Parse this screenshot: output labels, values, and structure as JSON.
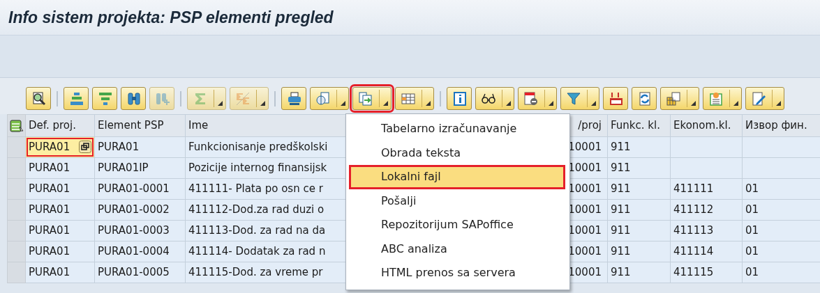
{
  "window": {
    "title": "Info sistem projekta: PSP elementi pregled"
  },
  "toolbar": [
    {
      "kind": "button",
      "dropdown": false,
      "disabled": false,
      "highlighted": false
    },
    {
      "kind": "separator"
    },
    {
      "kind": "button",
      "dropdown": false,
      "disabled": false,
      "highlighted": false
    },
    {
      "kind": "button",
      "dropdown": false,
      "disabled": false,
      "highlighted": false
    },
    {
      "kind": "button",
      "dropdown": false,
      "disabled": false,
      "highlighted": false
    },
    {
      "kind": "button",
      "dropdown": false,
      "disabled": true,
      "highlighted": false
    },
    {
      "kind": "separator"
    },
    {
      "kind": "button",
      "dropdown": true,
      "disabled": true,
      "highlighted": false
    },
    {
      "kind": "button",
      "dropdown": true,
      "disabled": true,
      "highlighted": false
    },
    {
      "kind": "separator"
    },
    {
      "kind": "button",
      "dropdown": false,
      "disabled": false,
      "highlighted": false
    },
    {
      "kind": "button",
      "dropdown": true,
      "disabled": false,
      "highlighted": false
    },
    {
      "kind": "button",
      "dropdown": true,
      "disabled": false,
      "highlighted": true
    },
    {
      "kind": "button",
      "dropdown": true,
      "disabled": false,
      "highlighted": false
    },
    {
      "kind": "separator"
    },
    {
      "kind": "button",
      "dropdown": false,
      "disabled": false,
      "highlighted": false
    },
    {
      "kind": "button",
      "dropdown": true,
      "disabled": false,
      "highlighted": false
    },
    {
      "kind": "button",
      "dropdown": true,
      "disabled": false,
      "highlighted": false
    },
    {
      "kind": "button",
      "dropdown": true,
      "disabled": false,
      "highlighted": false
    },
    {
      "kind": "button",
      "dropdown": false,
      "disabled": false,
      "highlighted": false
    },
    {
      "kind": "button",
      "dropdown": false,
      "disabled": false,
      "highlighted": false
    },
    {
      "kind": "button",
      "dropdown": true,
      "disabled": false,
      "highlighted": false
    },
    {
      "kind": "button",
      "dropdown": true,
      "disabled": false,
      "highlighted": false
    },
    {
      "kind": "button",
      "dropdown": true,
      "disabled": false,
      "highlighted": false
    }
  ],
  "table": {
    "columns": [
      "Def. proj.",
      "Element PSP",
      "Ime",
      "/proj",
      "Funkc. kl.",
      "Ekonom.kl.",
      "Извор фин."
    ],
    "rows": [
      {
        "current": true,
        "def_proj": "PURA01",
        "element_psp": "PURA01",
        "ime": "Funkcionisanje predškolski",
        "proj": "10001",
        "funkc": "911"
      },
      {
        "current": false,
        "def_proj": "PURA01",
        "element_psp": "PURA01IP",
        "ime": "Pozicije internog finansijsk",
        "proj": "10001",
        "funkc": "911"
      },
      {
        "current": false,
        "def_proj": "PURA01",
        "element_psp": "PURA01-0001",
        "ime": "411111- Plata po osn ce r",
        "proj": "10001",
        "funkc": "911",
        "ekonom": "411111",
        "izvor": "01"
      },
      {
        "current": false,
        "def_proj": "PURA01",
        "element_psp": "PURA01-0002",
        "ime": "411112-Dod.za rad duzi o",
        "proj": "10001",
        "funkc": "911",
        "ekonom": "411112",
        "izvor": "01"
      },
      {
        "current": false,
        "def_proj": "PURA01",
        "element_psp": "PURA01-0003",
        "ime": "411113-Dod. za rad na da",
        "proj": "10001",
        "funkc": "911",
        "ekonom": "411113",
        "izvor": "01"
      },
      {
        "current": false,
        "def_proj": "PURA01",
        "element_psp": "PURA01-0004",
        "ime": "411114- Dodatak za rad n",
        "proj": "10001",
        "funkc": "911",
        "ekonom": "411114",
        "izvor": "01"
      },
      {
        "current": false,
        "def_proj": "PURA01",
        "element_psp": "PURA01-0005",
        "ime": "411115-Dod. za vreme pr",
        "proj": "10001",
        "funkc": "911",
        "ekonom": "411115",
        "izvor": "01"
      }
    ]
  },
  "menu": {
    "items": [
      {
        "label": "Tabelarno izračunavanje",
        "selected": false,
        "highlighted": false
      },
      {
        "label": "Obrada teksta",
        "selected": false,
        "highlighted": false
      },
      {
        "label": "Lokalni fajl",
        "selected": true,
        "highlighted": true
      },
      {
        "label": "Pošalji",
        "selected": false,
        "highlighted": false
      },
      {
        "label": "Repozitorijum SAPoffice",
        "selected": false,
        "highlighted": false
      },
      {
        "label": "ABC analiza",
        "selected": false,
        "highlighted": false
      },
      {
        "label": "HTML prenos sa servera",
        "selected": false,
        "highlighted": false
      }
    ]
  }
}
